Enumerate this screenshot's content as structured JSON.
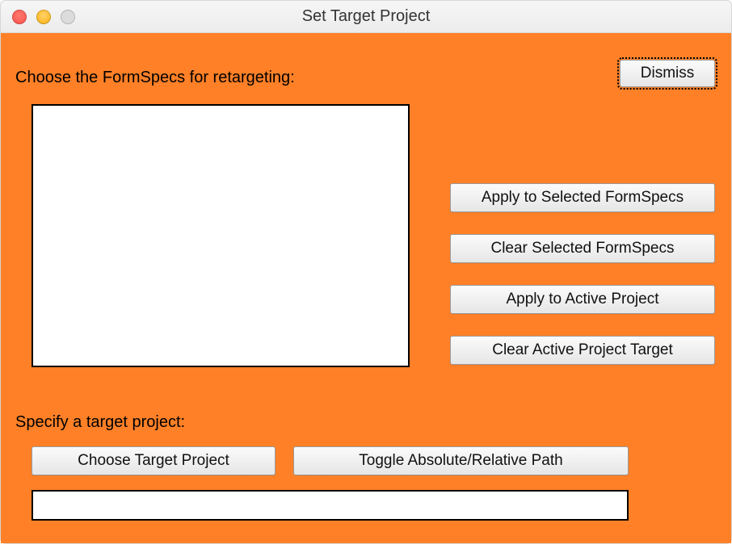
{
  "window": {
    "title": "Set Target Project"
  },
  "labels": {
    "choose_formspecs": "Choose the FormSpecs for retargeting:",
    "specify_target": "Specify a target project:"
  },
  "buttons": {
    "dismiss": "Dismiss",
    "apply_selected": "Apply to Selected FormSpecs",
    "clear_selected": "Clear Selected FormSpecs",
    "apply_active": "Apply to Active Project",
    "clear_active": "Clear Active Project Target",
    "choose_target": "Choose Target Project",
    "toggle_path": "Toggle Absolute/Relative Path"
  },
  "formspecs_list": [],
  "target_path": ""
}
